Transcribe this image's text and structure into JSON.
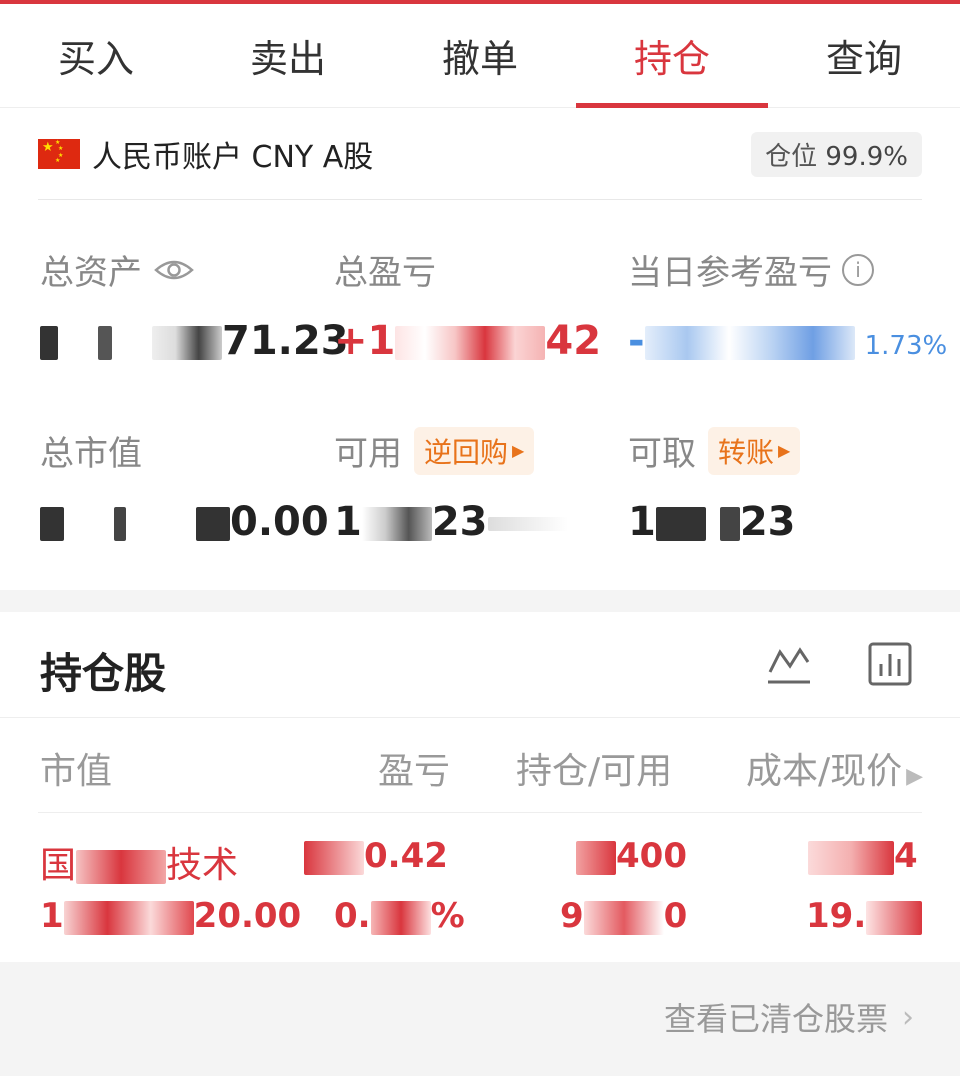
{
  "tabs": [
    {
      "label": "买入",
      "active": false
    },
    {
      "label": "卖出",
      "active": false
    },
    {
      "label": "撤单",
      "active": false
    },
    {
      "label": "持仓",
      "active": true
    },
    {
      "label": "查询",
      "active": false
    }
  ],
  "account": {
    "label": "人民币账户 CNY A股",
    "position_label": "仓位",
    "position_value": "99.9%"
  },
  "stats": {
    "total_assets": {
      "label": "总资产",
      "value_visible": "71.23"
    },
    "total_pnl": {
      "label": "总盈亏",
      "value_prefix": "+1",
      "value_visible": "42"
    },
    "daily_pnl": {
      "label": "当日参考盈亏",
      "value_prefix": "-",
      "pct": "1.73%"
    },
    "market_value": {
      "label": "总市值",
      "value_visible": "0.00"
    },
    "available": {
      "label": "可用",
      "link": "逆回购",
      "value_prefix": "1",
      "value_visible": "23"
    },
    "withdrawable": {
      "label": "可取",
      "link": "转账",
      "value_prefix": "1",
      "value_visible": "23"
    }
  },
  "holdings": {
    "title": "持仓股",
    "columns": [
      "市值",
      "盈亏",
      "持仓/可用",
      "成本/现价"
    ],
    "row": {
      "name_start": "国",
      "name_end": "技术",
      "market_value_start": "1",
      "market_value_end": "20.00",
      "pnl_end": "0.42",
      "pnl_pct_start": "0.",
      "pnl_pct_end": "%",
      "holding_end": "400",
      "available_start": "9",
      "available_end": "0",
      "cost_end": "4",
      "price_start": "19."
    }
  },
  "footer": {
    "link": "查看已清仓股票"
  },
  "colors": {
    "accent": "#d9363e",
    "loss_blue": "#4a8fe0",
    "link_orange": "#e8731b"
  }
}
